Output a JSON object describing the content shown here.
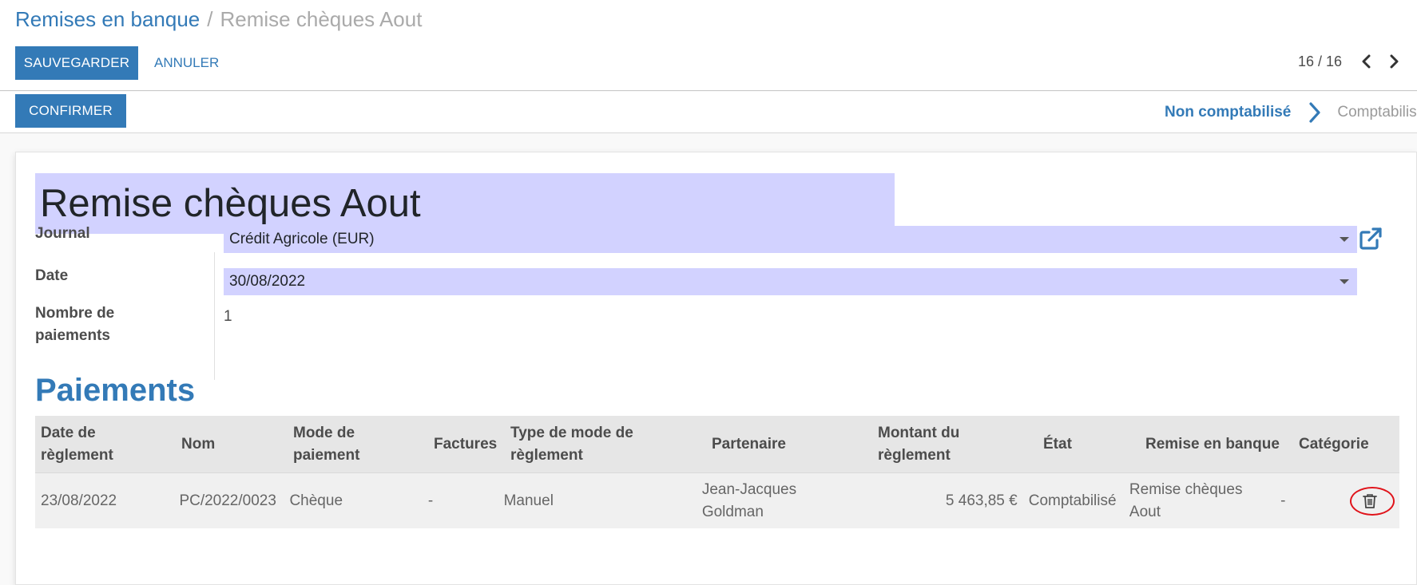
{
  "breadcrumb": {
    "parent": "Remises en banque",
    "separator": "/",
    "current": "Remise chèques Aout"
  },
  "toolbar": {
    "save_label": "SAUVEGARDER",
    "discard_label": "ANNULER"
  },
  "pager": {
    "value": "16 / 16",
    "prev_icon": "chevron-left-icon",
    "next_icon": "chevron-right-icon"
  },
  "statusbar": {
    "confirm_label": "CONFIRMER",
    "steps": [
      {
        "label": "Non comptabilisé",
        "active": true
      },
      {
        "label": "Comptabilis",
        "active": false
      }
    ]
  },
  "form": {
    "title": "Remise chèques Aout",
    "fields": {
      "journal": {
        "label": "Journal",
        "value": "Crédit Agricole (EUR)"
      },
      "date": {
        "label": "Date",
        "value": "30/08/2022"
      },
      "payment_count": {
        "label_line1": "Nombre de",
        "label_line2": "paiements",
        "value": "1"
      }
    },
    "external_link_icon": "external-link-icon"
  },
  "payments": {
    "section_title": "Paiements",
    "columns": [
      {
        "line1": "Date de",
        "line2": "règlement"
      },
      {
        "line1": "Nom",
        "line2": ""
      },
      {
        "line1": "Mode de",
        "line2": "paiement"
      },
      {
        "line1": "Factures",
        "line2": ""
      },
      {
        "line1": "Type de mode de",
        "line2": "règlement"
      },
      {
        "line1": "Partenaire",
        "line2": ""
      },
      {
        "line1": "Montant du",
        "line2": "règlement"
      },
      {
        "line1": "État",
        "line2": ""
      },
      {
        "line1": "Remise en banque",
        "line2": ""
      },
      {
        "line1": "Catégorie",
        "line2": ""
      }
    ],
    "rows": [
      {
        "date": "23/08/2022",
        "name": "PC/2022/0023",
        "mode": "Chèque",
        "invoices": "-",
        "mode_type": "Manuel",
        "partner_line1": "Jean-Jacques",
        "partner_line2": "Goldman",
        "amount": "5 463,85 €",
        "state": "Comptabilisé",
        "deposit_line1": "Remise chèques",
        "deposit_line2": "Aout",
        "category": "-",
        "delete_icon": "trash-icon"
      }
    ]
  },
  "colors": {
    "primary": "#337ab7",
    "field_highlight": "#d2d2ff",
    "annotation_circle": "#e0131a"
  }
}
